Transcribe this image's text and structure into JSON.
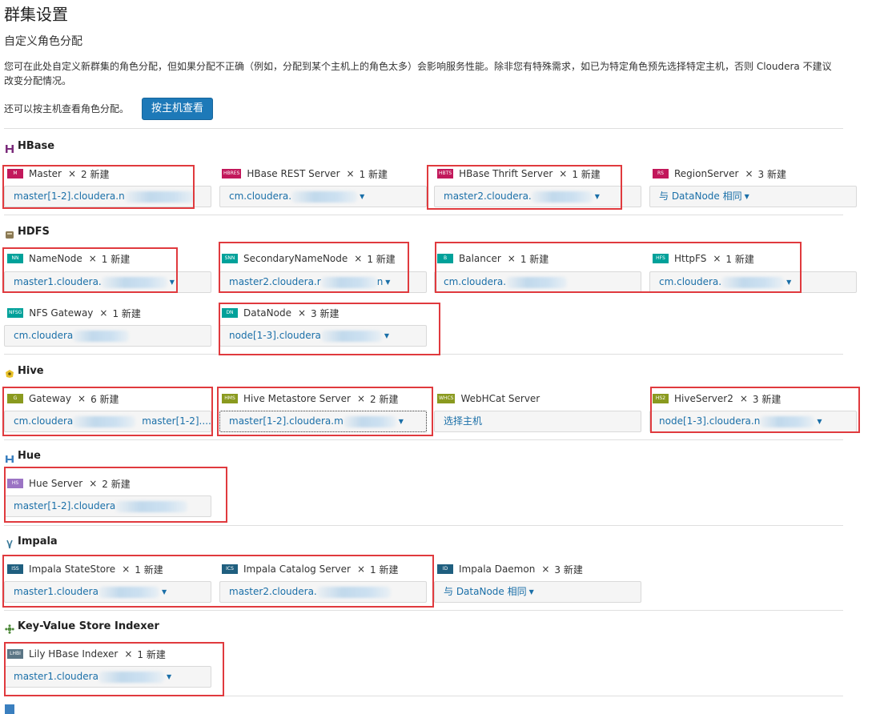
{
  "page": {
    "title": "群集设置",
    "subtitle": "自定义角色分配",
    "description": "您可在此处自定义新群集的角色分配，但如果分配不正确（例如，分配到某个主机上的角色太多）会影响服务性能。除非您有特殊需求，如已为特定角色预先选择特定主机，否则 Cloudera 不建议改变分配情况。",
    "host_view_text": "还可以按主机查看角色分配。",
    "host_view_button": "按主机查看"
  },
  "common": {
    "close": "×"
  },
  "colors": {
    "accent": "#1d79b8",
    "link": "#1a6fa8",
    "highlight_box": "#e03a3e",
    "badge_hbase": "#c2185b",
    "badge_hdfs": "#00a19a",
    "badge_hive": "#8a9a1f",
    "badge_hue": "#9b74c4",
    "badge_impala": "#1f5f7f",
    "badge_kv": "#5a7585"
  },
  "sections": {
    "hbase": {
      "title": "HBase",
      "icon": "hbase-icon",
      "roles": {
        "master": {
          "badge": "M",
          "name": "Master",
          "count": "2 新建",
          "host": "master[1-2].cloudera.n"
        },
        "rest": {
          "badge": "HBRES",
          "name": "HBase REST Server",
          "count": "1 新建",
          "host": "cm.cloudera."
        },
        "thrift": {
          "badge": "HBTS",
          "name": "HBase Thrift Server",
          "count": "1 新建",
          "host": "master2.cloudera."
        },
        "regionserver": {
          "badge": "RS",
          "name": "RegionServer",
          "count": "3 新建",
          "host": "与 DataNode 相同"
        }
      }
    },
    "hdfs": {
      "title": "HDFS",
      "icon": "hdfs-icon",
      "roles": {
        "namenode": {
          "badge": "NN",
          "name": "NameNode",
          "count": "1 新建",
          "host": "master1.cloudera."
        },
        "snn": {
          "badge": "SNN",
          "name": "SecondaryNameNode",
          "count": "1 新建",
          "host": "master2.cloudera.r",
          "host_after": "n"
        },
        "balancer": {
          "badge": "B",
          "name": "Balancer",
          "count": "1 新建",
          "host": "cm.cloudera."
        },
        "httpfs": {
          "badge": "HFS",
          "name": "HttpFS",
          "count": "1 新建",
          "host": "cm.cloudera."
        },
        "nfs": {
          "badge": "NFSG",
          "name": "NFS Gateway",
          "count": "1 新建",
          "host": "cm.cloudera"
        },
        "datanode": {
          "badge": "DN",
          "name": "DataNode",
          "count": "3 新建",
          "host": "node[1-3].cloudera"
        }
      }
    },
    "hive": {
      "title": "Hive",
      "icon": "hive-icon",
      "roles": {
        "gateway": {
          "badge": "G",
          "name": "Gateway",
          "count": "6 新建",
          "host": "cm.cloudera",
          "host_after": "master[1-2]...."
        },
        "metastore": {
          "badge": "HMS",
          "name": "Hive Metastore Server",
          "count": "2 新建",
          "host": "master[1-2].cloudera.m"
        },
        "webhcat": {
          "badge": "WHCS",
          "name": "WebHCat Server",
          "count": "",
          "host": "选择主机"
        },
        "hs2": {
          "badge": "HS2",
          "name": "HiveServer2",
          "count": "3 新建",
          "host": "node[1-3].cloudera.n"
        }
      }
    },
    "hue": {
      "title": "Hue",
      "icon": "hue-icon",
      "roles": {
        "hueserver": {
          "badge": "HS",
          "name": "Hue Server",
          "count": "2 新建",
          "host": "master[1-2].cloudera"
        }
      }
    },
    "impala": {
      "title": "Impala",
      "icon": "impala-icon",
      "roles": {
        "statestore": {
          "badge": "ISS",
          "name": "Impala StateStore",
          "count": "1 新建",
          "host": "master1.cloudera"
        },
        "catalog": {
          "badge": "ICS",
          "name": "Impala Catalog Server",
          "count": "1 新建",
          "host": "master2.cloudera."
        },
        "daemon": {
          "badge": "ID",
          "name": "Impala Daemon",
          "count": "3 新建",
          "host": "与 DataNode 相同"
        }
      }
    },
    "kv": {
      "title": "Key-Value Store Indexer",
      "icon": "key-value-store-icon",
      "roles": {
        "lily": {
          "badge": "LHBI",
          "name": "Lily HBase Indexer",
          "count": "1 新建",
          "host": "master1.cloudera"
        }
      }
    }
  }
}
